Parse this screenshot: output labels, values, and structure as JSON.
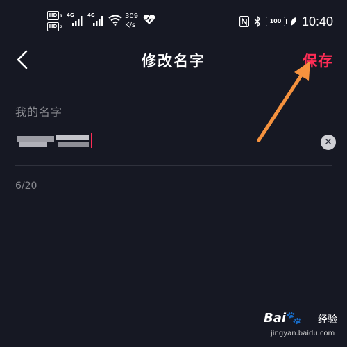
{
  "status_bar": {
    "hd1": "HD",
    "hd1_sub": "1",
    "hd2": "HD",
    "hd2_sub": "2",
    "net1": "4G",
    "net2": "4G",
    "speed_value": "309",
    "speed_unit": "K/s",
    "battery": "100",
    "time": "10:40"
  },
  "nav": {
    "title": "修改名字",
    "save_label": "保存"
  },
  "form": {
    "field_label": "我的名字",
    "char_count": "6/20"
  },
  "watermark": {
    "logo_left": "Bai",
    "logo_paw": "🐾",
    "logo_right": "经验",
    "url": "jingyan.baidu.com"
  },
  "colors": {
    "background": "#161823",
    "accent": "#fe2c55",
    "annotation_arrow": "#f5923e",
    "muted_text": "#8a8b91"
  }
}
